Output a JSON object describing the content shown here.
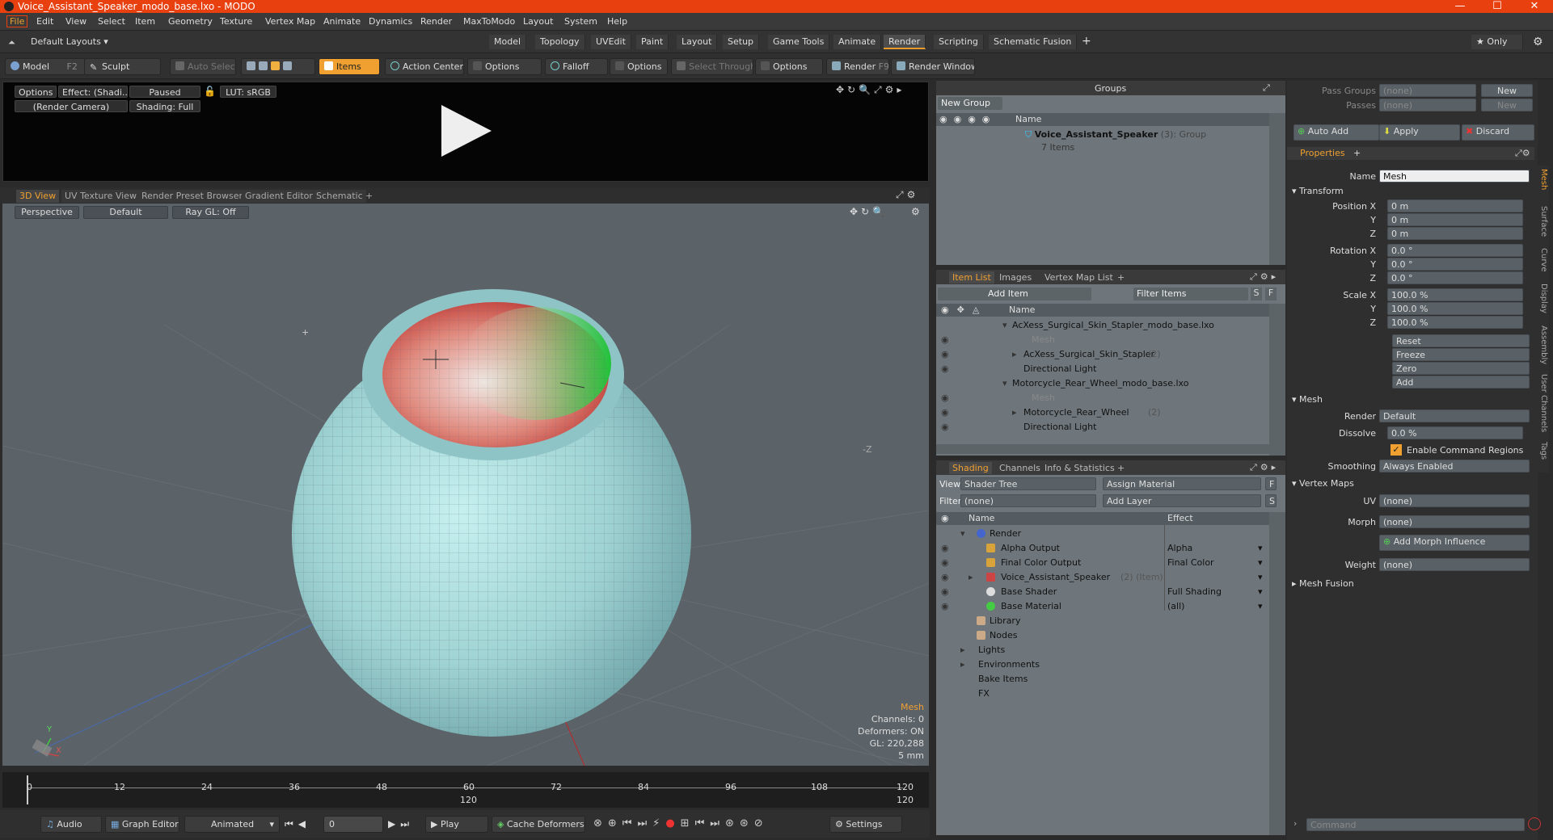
{
  "window": {
    "title": "Voice_Assistant_Speaker_modo_base.lxo - MODO",
    "min": "—",
    "max": "☐",
    "close": "✕"
  },
  "menu": [
    "File",
    "Edit",
    "View",
    "Select",
    "Item",
    "Geometry",
    "Texture",
    "Vertex Map",
    "Animate",
    "Dynamics",
    "Render",
    "MaxToModo",
    "Layout",
    "System",
    "Help"
  ],
  "layout": {
    "selector": "Default Layouts ▾",
    "tabs": [
      "Model",
      "Topology",
      "UVEdit",
      "Paint",
      "Layout",
      "Setup",
      "Game Tools",
      "Animate",
      "Render",
      "Scripting",
      "Schematic Fusion",
      "+"
    ],
    "active_tab": "Render",
    "only": "★  Only"
  },
  "toolbar": {
    "model": "Model",
    "model_key": "F2",
    "sculpt": "Sculpt",
    "auto_select": "Auto Select",
    "items": "Items",
    "action_center": "Action Center",
    "options1": "Options",
    "falloff": "Falloff",
    "options2": "Options",
    "select_through": "Select Through",
    "options3": "Options",
    "render": "Render",
    "render_key": "F9",
    "render_window": "Render Window"
  },
  "preview": {
    "options": "Options",
    "effect": "Effect: (Shadi...",
    "paused": "Paused",
    "lut": "LUT: sRGB",
    "camera": "(Render Camera)",
    "shading": "Shading: Full"
  },
  "viewport_tabs": [
    "3D View",
    "UV Texture View",
    "Render Preset Browser",
    "Gradient Editor",
    "Schematic",
    "+"
  ],
  "viewport": {
    "perspective": "Perspective",
    "default": "Default",
    "raygl": "Ray GL: Off",
    "info_title": "Mesh",
    "channels": "Channels: 0",
    "deformers": "Deformers: ON",
    "gl": "GL: 220,288",
    "scale": "5 mm",
    "axis_z": "-Z",
    "axis_y": "Y",
    "axis_x": "X"
  },
  "timeline": {
    "ticks": [
      "0",
      "12",
      "24",
      "36",
      "48",
      "60",
      "72",
      "84",
      "96",
      "108",
      "120"
    ],
    "mid_label": "120",
    "end_label": "120"
  },
  "transport": {
    "audio": "Audio",
    "graph_editor": "Graph Editor",
    "animated": "Animated",
    "frame": "0",
    "play": "Play",
    "cache": "Cache Deformers",
    "settings": "Settings"
  },
  "groups": {
    "title": "Groups",
    "new_group": "New Group",
    "col_name": "Name",
    "item_name": "Voice_Assistant_Speaker",
    "item_count": "(3)",
    "item_type": ": Group",
    "item_sub": "7 Items"
  },
  "itemlist": {
    "tabs": [
      "Item List",
      "Images",
      "Vertex Map List",
      "+"
    ],
    "add_item": "Add Item",
    "filter": "Filter Items",
    "s": "S",
    "f": "F",
    "col_name": "Name",
    "rows": [
      {
        "label": "AcXess_Surgical_Skin_Stapler_modo_base.lxo",
        "indent": 0,
        "dim": false
      },
      {
        "label": "Mesh",
        "indent": 2,
        "dim": true
      },
      {
        "label": "AcXess_Surgical_Skin_Stapler",
        "suffix": "(2)",
        "indent": 1,
        "dim": false
      },
      {
        "label": "Directional Light",
        "indent": 1,
        "dim": false
      },
      {
        "label": "Motorcycle_Rear_Wheel_modo_base.lxo",
        "indent": 0,
        "dim": false
      },
      {
        "label": "Mesh",
        "indent": 2,
        "dim": true
      },
      {
        "label": "Motorcycle_Rear_Wheel",
        "suffix": "(2)",
        "indent": 1,
        "dim": false
      },
      {
        "label": "Directional Light",
        "indent": 1,
        "dim": false
      }
    ]
  },
  "shading": {
    "tabs": [
      "Shading",
      "Channels",
      "Info & Statistics",
      "+"
    ],
    "view_label": "View",
    "view_value": "Shader Tree",
    "assign": "Assign Material",
    "f": "F",
    "filter_label": "Filter",
    "filter_value": "(none)",
    "add_layer": "Add Layer",
    "s": "S",
    "col_name": "Name",
    "col_effect": "Effect",
    "rows": [
      {
        "label": "Render",
        "effect": "",
        "indent": 0
      },
      {
        "label": "Alpha Output",
        "effect": "Alpha",
        "indent": 1
      },
      {
        "label": "Final Color Output",
        "effect": "Final Color",
        "indent": 1
      },
      {
        "label": "Voice_Assistant_Speaker",
        "suffix": "(2) (Item)",
        "effect": "",
        "indent": 1
      },
      {
        "label": "Base Shader",
        "effect": "Full Shading",
        "indent": 1
      },
      {
        "label": "Base Material",
        "effect": "(all)",
        "indent": 1
      },
      {
        "label": "Library",
        "effect": "",
        "indent": 0
      },
      {
        "label": "Nodes",
        "effect": "",
        "indent": 0
      },
      {
        "label": "Lights",
        "effect": "",
        "indent": -1
      },
      {
        "label": "Environments",
        "effect": "",
        "indent": -1
      },
      {
        "label": "Bake Items",
        "effect": "",
        "indent": -1
      },
      {
        "label": "FX",
        "effect": "",
        "indent": -1
      }
    ]
  },
  "props": {
    "pass_groups": "Pass Groups",
    "passes": "Passes",
    "none": "(none)",
    "new": "New",
    "auto_add": "Auto Add",
    "apply": "Apply",
    "discard": "Discard",
    "tab": "Properties",
    "plus": "+",
    "name_label": "Name",
    "name_value": "Mesh",
    "transform": "Transform",
    "position_x": "Position X",
    "rotation_x": "Rotation X",
    "scale_x": "Scale X",
    "y": "Y",
    "z": "Z",
    "pos": [
      "0 m",
      "0 m",
      "0 m"
    ],
    "rot": [
      "0.0 °",
      "0.0 °",
      "0.0 °"
    ],
    "scl": [
      "100.0 %",
      "100.0 %",
      "100.0 %"
    ],
    "reset": "Reset",
    "freeze": "Freeze",
    "zero": "Zero",
    "add": "Add",
    "mesh": "Mesh",
    "render_label": "Render",
    "render_value": "Default",
    "dissolve_label": "Dissolve",
    "dissolve_value": "0.0 %",
    "enable_cmd": "Enable Command Regions",
    "smoothing_label": "Smoothing",
    "smoothing_value": "Always Enabled",
    "vertex_maps": "Vertex Maps",
    "uv_label": "UV",
    "uv_value": "(none)",
    "morph_label": "Morph",
    "morph_value": "(none)",
    "add_morph": "Add Morph Influence",
    "weight_label": "Weight",
    "weight_value": "(none)",
    "mesh_fusion": "Mesh Fusion",
    "command": "Command",
    "side_tabs": [
      "Mesh",
      "Surface",
      "Curve",
      "Display",
      "Assembly",
      "User Channels",
      "Tags"
    ]
  }
}
